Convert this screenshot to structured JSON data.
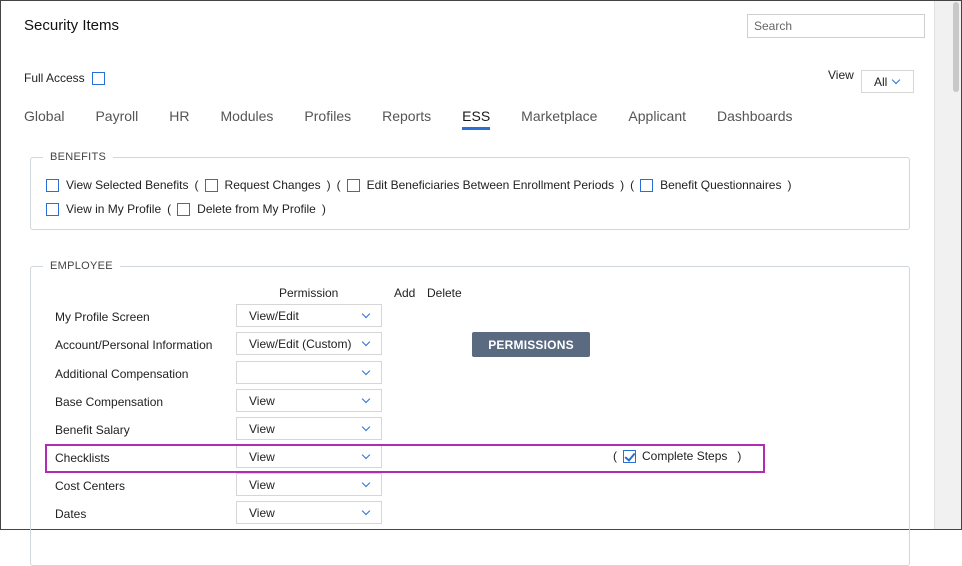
{
  "title": "Security Items",
  "search": {
    "placeholder": "Search"
  },
  "full_access": {
    "label": "Full Access",
    "checked": false
  },
  "view": {
    "label": "View",
    "selected": "All"
  },
  "tabs": [
    {
      "label": "Global",
      "active": false
    },
    {
      "label": "Payroll",
      "active": false
    },
    {
      "label": "HR",
      "active": false
    },
    {
      "label": "Modules",
      "active": false
    },
    {
      "label": "Profiles",
      "active": false
    },
    {
      "label": "Reports",
      "active": false
    },
    {
      "label": "ESS",
      "active": true
    },
    {
      "label": "Marketplace",
      "active": false
    },
    {
      "label": "Applicant",
      "active": false
    },
    {
      "label": "Dashboards",
      "active": false
    }
  ],
  "benefits": {
    "legend": "BENEFITS",
    "items": [
      {
        "label": "View Selected Benefits"
      },
      {
        "label": "Request Changes"
      },
      {
        "label": "Edit Beneficiaries Between Enrollment Periods"
      },
      {
        "label": "Benefit Questionnaires"
      },
      {
        "label": "View in My Profile"
      },
      {
        "label": "Delete from My Profile"
      }
    ],
    "paren_open": "(",
    "paren_close": ")"
  },
  "employee": {
    "legend": "EMPLOYEE",
    "headers": {
      "permission": "Permission",
      "add": "Add",
      "delete": "Delete"
    },
    "permissions_button": "PERMISSIONS",
    "rows": [
      {
        "label": "My Profile Screen",
        "value": "View/Edit"
      },
      {
        "label": "Account/Personal Information",
        "value": "View/Edit (Custom)"
      },
      {
        "label": "Additional Compensation",
        "value": ""
      },
      {
        "label": "Base Compensation",
        "value": "View"
      },
      {
        "label": "Benefit Salary",
        "value": "View"
      },
      {
        "label": "Checklists",
        "value": "View"
      },
      {
        "label": "Cost Centers",
        "value": "View"
      },
      {
        "label": "Dates",
        "value": "View"
      }
    ],
    "checklists_extra": {
      "paren_open": "(",
      "label": "Complete Steps",
      "checked": true,
      "paren_close": ")"
    }
  },
  "colors": {
    "accent": "#2a6fd6",
    "button_bg": "#5a6a80",
    "highlight": "#b32bb3"
  }
}
